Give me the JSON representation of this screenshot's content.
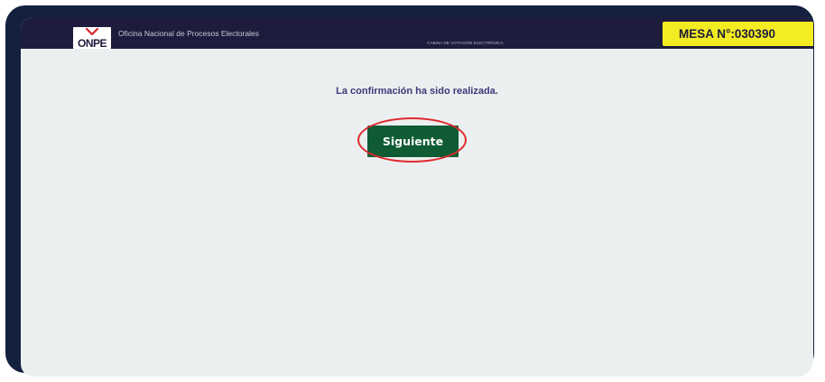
{
  "header": {
    "logo_text": "ONPE",
    "org_name": "Oficina Nacional de Procesos Electorales",
    "subtitle": "CABINA DE VOTACIÓN ELECTRÓNICA",
    "mesa_label": "MESA N°:",
    "mesa_number": "030390"
  },
  "main": {
    "message": "La confirmación ha sido realizada.",
    "next_button_label": "Siguiente"
  },
  "colors": {
    "frame": "#14203f",
    "header_bg": "#1d1c3c",
    "screen_bg": "#ecefef",
    "mesa_badge": "#f3ec22",
    "message_text": "#3b3a7a",
    "button_bg": "#0e5b34",
    "highlight_ring": "#e0282e"
  }
}
